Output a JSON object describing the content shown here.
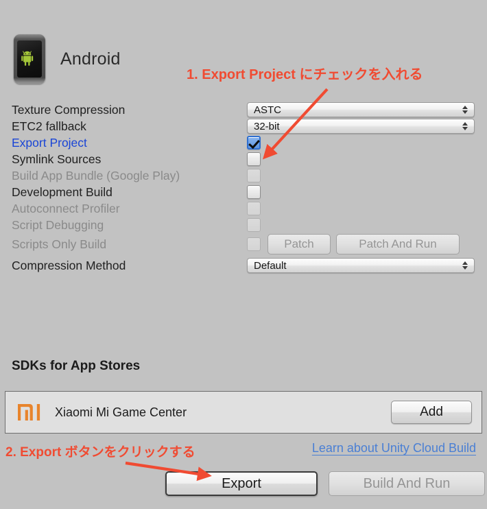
{
  "platform": {
    "name": "Android",
    "icon": "android-phone-icon"
  },
  "settings": {
    "rows": [
      {
        "label": "Texture Compression",
        "type": "popup",
        "value": "ASTC",
        "disabled": false
      },
      {
        "label": "ETC2 fallback",
        "type": "popup",
        "value": "32-bit",
        "disabled": false
      },
      {
        "label": "Export Project",
        "type": "checkbox",
        "checked": true,
        "disabled": false,
        "highlighted": true
      },
      {
        "label": "Symlink Sources",
        "type": "checkbox",
        "checked": false,
        "disabled": false,
        "highlighted": false
      },
      {
        "label": "Build App Bundle (Google Play)",
        "type": "checkbox",
        "checked": false,
        "disabled": true,
        "highlighted": false
      },
      {
        "label": "Development Build",
        "type": "checkbox",
        "checked": false,
        "disabled": false,
        "highlighted": false
      },
      {
        "label": "Autoconnect Profiler",
        "type": "checkbox",
        "checked": false,
        "disabled": true,
        "highlighted": false
      },
      {
        "label": "Script Debugging",
        "type": "checkbox",
        "checked": false,
        "disabled": true,
        "highlighted": false
      },
      {
        "label": "Scripts Only Build",
        "type": "checkbox",
        "checked": false,
        "disabled": true,
        "highlighted": false
      },
      {
        "label": "Compression Method",
        "type": "popup",
        "value": "Default",
        "disabled": false
      }
    ],
    "patch_button": "Patch",
    "patch_and_run_button": "Patch And Run"
  },
  "sdk_section": {
    "heading": "SDKs for App Stores",
    "entry": {
      "name": "Xiaomi Mi Game Center",
      "logo": "xiaomi-mi-logo",
      "logo_color": "#e8842c",
      "add_button": "Add"
    }
  },
  "footer": {
    "cloud_build_link": "Learn about Unity Cloud Build",
    "export_button": "Export",
    "build_and_run_button": "Build And Run"
  },
  "annotations": [
    {
      "id": "step-1",
      "text": "1. Export Project にチェックを入れる",
      "color": "#f04b32"
    },
    {
      "id": "step-2",
      "text": "2. Export ボタンをクリックする",
      "color": "#f04b32"
    }
  ],
  "colors": {
    "background": "#c2c2c2",
    "annotation": "#f04b32",
    "link": "#4a7fd4",
    "active_label": "#1a45d6",
    "disabled_label": "#8a8a8a",
    "panel": "#e0e0e0"
  }
}
